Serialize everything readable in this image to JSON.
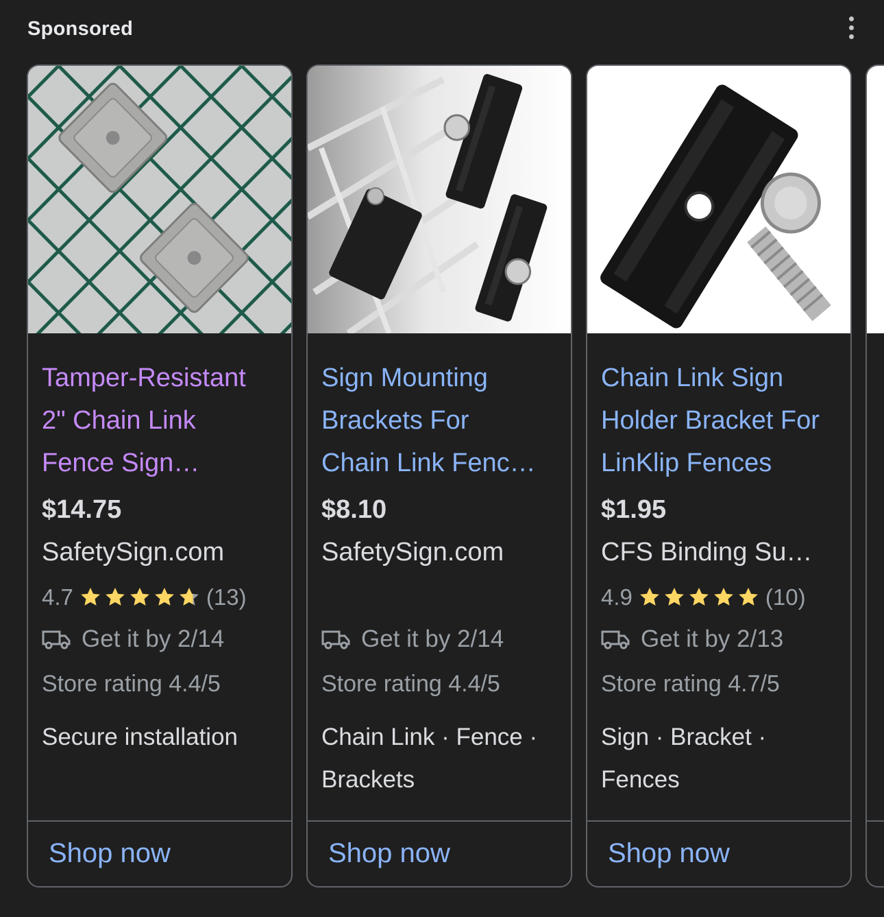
{
  "header": {
    "label": "Sponsored",
    "menu_icon": "more-vert-icon"
  },
  "colors": {
    "link": "#8ab4f8",
    "visited": "#c58af9",
    "star": "#fdd663",
    "star_empty": "#9aa0a6",
    "background": "#1f1f1f"
  },
  "products": [
    {
      "title_lines": [
        "Tamper-Resistant",
        "2\" Chain Link",
        "Fence Sign…"
      ],
      "price": "$14.75",
      "merchant": "SafetySign.com",
      "rating": "4.7",
      "reviews": "(13)",
      "star_fill": 0.94,
      "delivery": "Get it by 2/14",
      "store_rating": "Store rating 4.4/5",
      "tags_lines": [
        "Secure installation"
      ],
      "cta": "Shop now"
    },
    {
      "title_lines": [
        "Sign Mounting",
        "Brackets For",
        "Chain Link Fenc…"
      ],
      "price": "$8.10",
      "merchant": "SafetySign.com",
      "delivery": "Get it by 2/14",
      "store_rating": "Store rating 4.4/5",
      "tags_lines": [
        "Chain Link · Fence ·",
        "Brackets"
      ],
      "cta": "Shop now"
    },
    {
      "title_lines": [
        "Chain Link Sign",
        "Holder Bracket For",
        "LinKlip Fences"
      ],
      "price": "$1.95",
      "merchant": "CFS Binding Su…",
      "rating": "4.9",
      "reviews": "(10)",
      "star_fill": 1.0,
      "delivery": "Get it by 2/13",
      "store_rating": "Store rating 4.7/5",
      "tags_lines": [
        "Sign · Bracket ·",
        "Fences"
      ],
      "cta": "Shop now"
    }
  ]
}
